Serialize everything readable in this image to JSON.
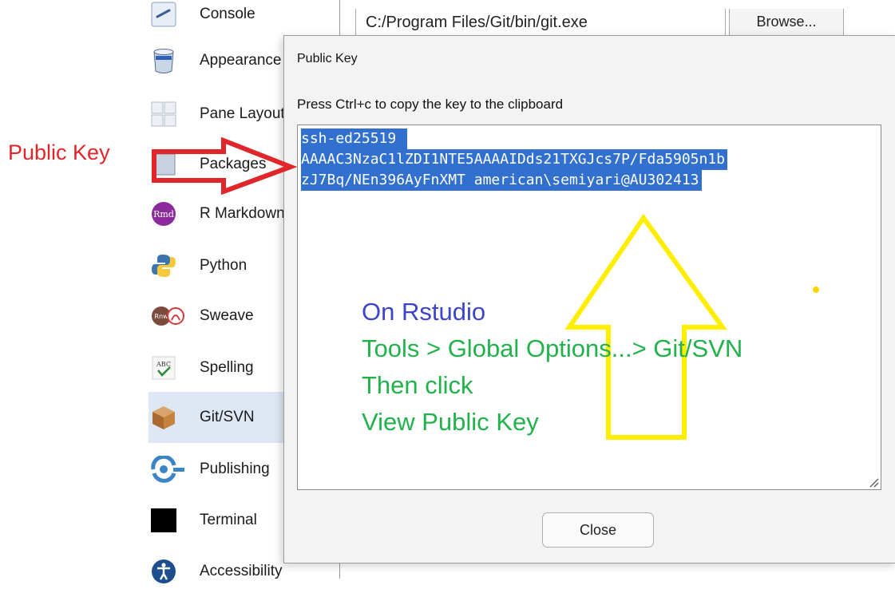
{
  "sidebar": {
    "items": [
      {
        "label": "Console",
        "icon": "console-icon"
      },
      {
        "label": "Appearance",
        "icon": "appearance-icon"
      },
      {
        "label": "Pane Layout",
        "icon": "pane-layout-icon"
      },
      {
        "label": "Packages",
        "icon": "packages-icon"
      },
      {
        "label": "R Markdown",
        "icon": "rmarkdown-icon",
        "icon_text": "Rmd"
      },
      {
        "label": "Python",
        "icon": "python-icon"
      },
      {
        "label": "Sweave",
        "icon": "sweave-icon",
        "icon_text": "Rnw"
      },
      {
        "label": "Spelling",
        "icon": "spelling-icon",
        "icon_text": "ABC"
      },
      {
        "label": "Git/SVN",
        "icon": "git-svn-icon",
        "selected": true
      },
      {
        "label": "Publishing",
        "icon": "publishing-icon"
      },
      {
        "label": "Terminal",
        "icon": "terminal-icon"
      },
      {
        "label": "Accessibility",
        "icon": "accessibility-icon"
      }
    ],
    "selected_color": "#dde8f4"
  },
  "git": {
    "executable_path": "C:/Program Files/Git/bin/git.exe",
    "browse_label": "Browse..."
  },
  "dialog": {
    "title": "Public Key",
    "instruction": "Press Ctrl+c to copy the key to the clipboard",
    "key_lines": [
      "ssh-ed25519 ",
      "AAAAC3NzaC1lZDI1NTE5AAAAIDds21TXGJcs7P/Fda5905n1b",
      "zJ7Bq/NEn396AyFnXMT american\\semiyari@AU302413"
    ],
    "selection_color": "#3270d0",
    "close_label": "Close"
  },
  "annotations": {
    "side_label": "Public Key",
    "side_label_color": "#e0252b",
    "arrow_color": "#e0252b",
    "up_arrow_color": "#ffee00",
    "steps": [
      {
        "text": "On Rstudio",
        "color": "#3c44c8"
      },
      {
        "text": "Tools > Global Options...> Git/SVN",
        "color": "#22b24c"
      },
      {
        "text": "Then click",
        "color": "#22b24c"
      },
      {
        "text": "View Public Key",
        "color": "#22b24c"
      }
    ]
  }
}
